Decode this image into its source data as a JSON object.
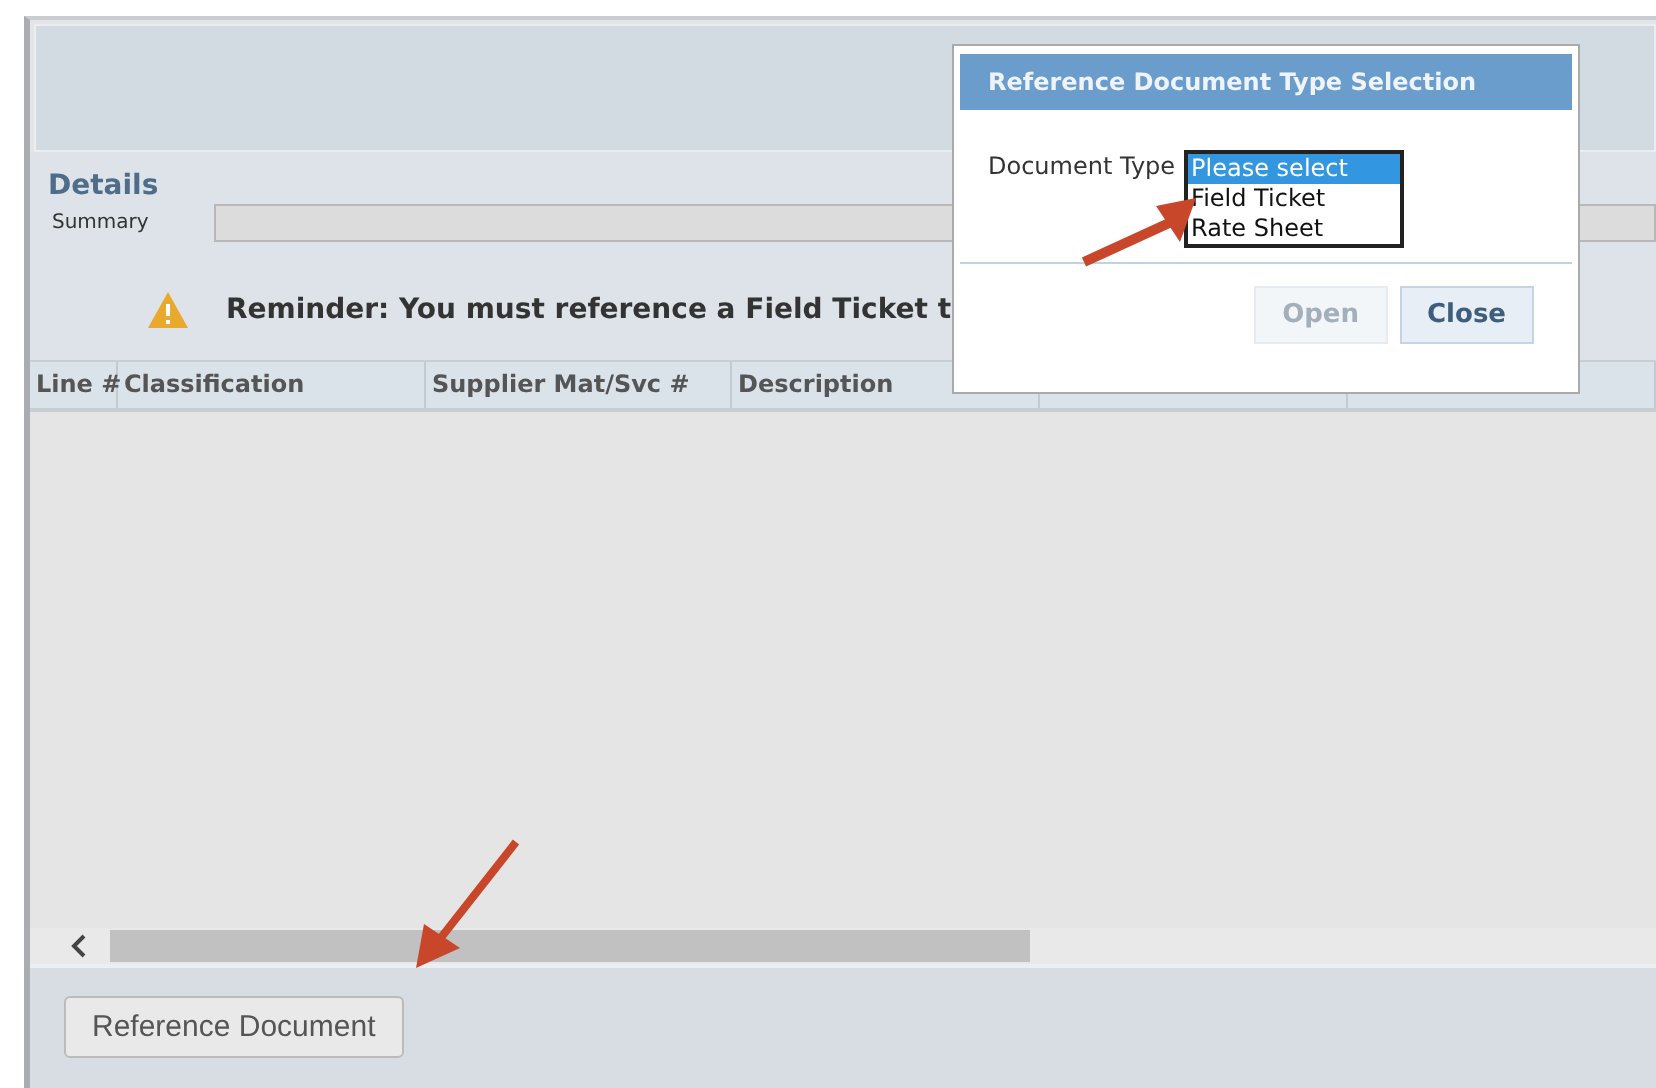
{
  "details": {
    "title": "Details",
    "summary_label": "Summary"
  },
  "reminder": {
    "text": "Reminder: You must reference a Field Ticket t"
  },
  "table": {
    "columns": [
      "Line #",
      "Classification",
      "Supplier Mat/Svc #",
      "Description"
    ]
  },
  "footer": {
    "button": "Reference Document"
  },
  "dialog": {
    "title": "Reference Document Type Selection",
    "field_label": "Document Type",
    "options": [
      {
        "label": "Please select",
        "selected": true
      },
      {
        "label": "Field Ticket",
        "selected": false
      },
      {
        "label": "Rate Sheet",
        "selected": false
      }
    ],
    "buttons": [
      {
        "label": "Open",
        "disabled": true
      },
      {
        "label": "Close",
        "disabled": false
      }
    ]
  }
}
